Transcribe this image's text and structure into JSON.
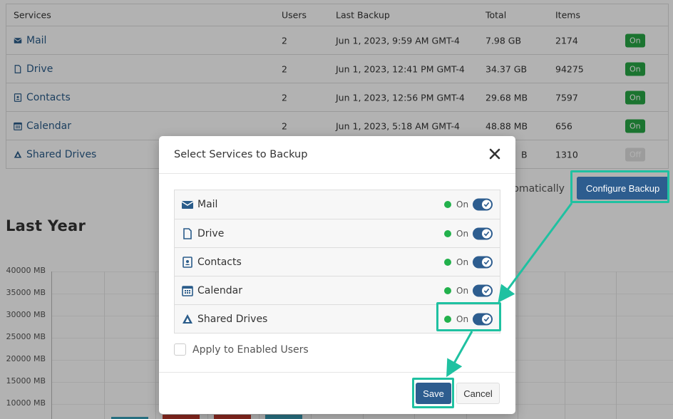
{
  "table": {
    "headers": [
      "Services",
      "Users",
      "Last Backup",
      "Total",
      "Items"
    ],
    "rows": [
      {
        "service": "Mail",
        "icon": "envelope-icon",
        "users": "2",
        "last_backup": "Jun 1, 2023, 9:59 AM GMT-4",
        "total": "7.98 GB",
        "items": "2174",
        "status": "On"
      },
      {
        "service": "Drive",
        "icon": "file-icon",
        "users": "2",
        "last_backup": "Jun 1, 2023, 12:41 PM GMT-4",
        "total": "34.37 GB",
        "items": "94275",
        "status": "On"
      },
      {
        "service": "Contacts",
        "icon": "contact-card-icon",
        "users": "2",
        "last_backup": "Jun 1, 2023, 12:56 PM GMT-4",
        "total": "29.68 MB",
        "items": "7597",
        "status": "On"
      },
      {
        "service": "Calendar",
        "icon": "calendar-icon",
        "users": "2",
        "last_backup": "Jun 1, 2023, 5:18 AM GMT-4",
        "total": "48.88 MB",
        "items": "656",
        "status": "On"
      },
      {
        "service": "Shared Drives",
        "icon": "drive-triangle-icon",
        "users": "",
        "last_backup": "",
        "total": "B",
        "items": "1310",
        "status": "Off"
      }
    ]
  },
  "background": {
    "auto_text": "utomatically",
    "configure_button": "Configure Backup",
    "section_title": "Last Year",
    "y_axis_ticks": [
      "40000 MB",
      "35000 MB",
      "30000 MB",
      "25000 MB",
      "20000 MB",
      "15000 MB",
      "10000 MB"
    ]
  },
  "modal": {
    "title": "Select Services to Backup",
    "items": [
      {
        "label": "Mail",
        "icon": "envelope-icon",
        "state": "On",
        "enabled": true
      },
      {
        "label": "Drive",
        "icon": "file-icon",
        "state": "On",
        "enabled": true
      },
      {
        "label": "Contacts",
        "icon": "contact-card-icon",
        "state": "On",
        "enabled": true
      },
      {
        "label": "Calendar",
        "icon": "calendar-icon",
        "state": "On",
        "enabled": true
      },
      {
        "label": "Shared Drives",
        "icon": "drive-triangle-icon",
        "state": "On",
        "enabled": true
      }
    ],
    "apply_checkbox_label": "Apply to Enabled Users",
    "apply_checked": false,
    "save_label": "Save",
    "cancel_label": "Cancel"
  },
  "colors": {
    "primary": "#2d5d8f",
    "success": "#28a745",
    "highlight": "#1fc1a1",
    "status_dot": "#22b14c"
  }
}
